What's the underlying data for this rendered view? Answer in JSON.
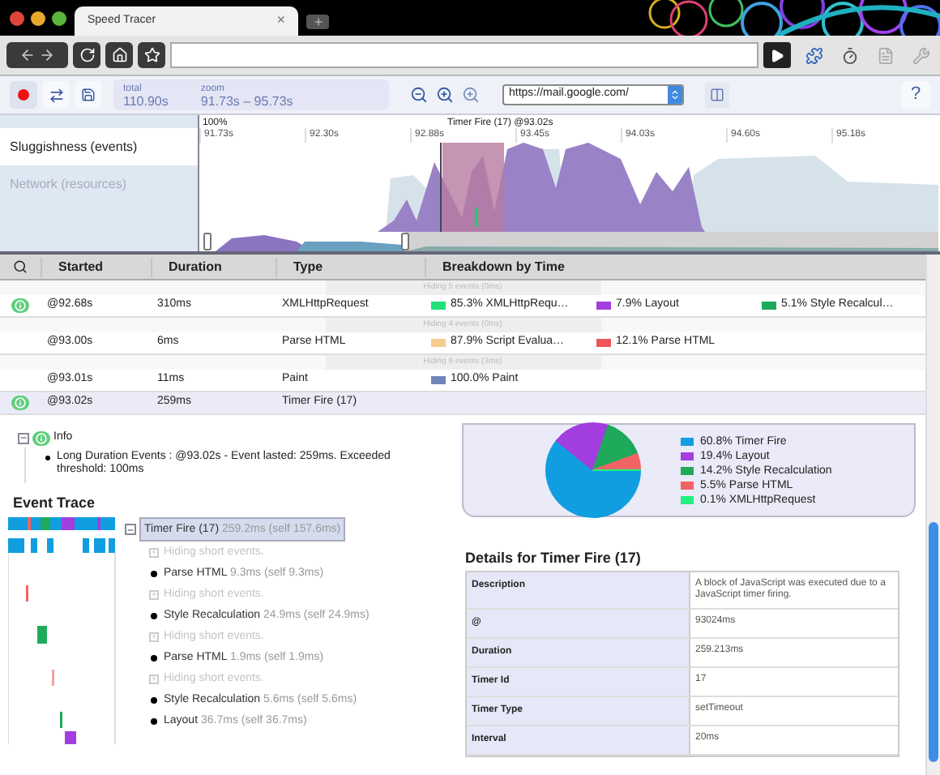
{
  "browser": {
    "tab_title": "Speed Tracer",
    "tab_close": "×"
  },
  "toolbar": {
    "total_label": "total",
    "total": "110.90s",
    "zoom_label": "zoom",
    "zoom": "91.73s – 95.73s",
    "url": "https://mail.google.com/",
    "help": "?"
  },
  "timeline": {
    "rows": [
      {
        "label": "Sluggishness (events)",
        "selected": true
      },
      {
        "label": "Network (resources)",
        "selected": false
      }
    ],
    "scale": "100%",
    "marker": "Timer Fire (17) @93.02s",
    "ticks": [
      "91.73s",
      "92.30s",
      "92.88s",
      "93.45s",
      "94.03s",
      "94.60s",
      "95.18s"
    ]
  },
  "table": {
    "columns": [
      "Started",
      "Duration",
      "Type",
      "Breakdown by Time"
    ],
    "rows": [
      {
        "kind": "hidden",
        "text": "Hiding 5 events (0ms)"
      },
      {
        "kind": "event",
        "info": true,
        "selected": false,
        "started": "@92.68s",
        "duration": "310ms",
        "type": "XMLHttpRequest",
        "breakdown": [
          {
            "color": "#22e07a",
            "text": "85.3% XMLHttpRequ…"
          },
          {
            "color": "#a23ee0",
            "text": "7.9% Layout"
          },
          {
            "color": "#1eaa5a",
            "text": "5.1% Style Recalcul…"
          }
        ]
      },
      {
        "kind": "hidden",
        "text": "Hiding 4 events (0ms)"
      },
      {
        "kind": "event",
        "info": false,
        "selected": false,
        "started": "@93.00s",
        "duration": "6ms",
        "type": "Parse HTML",
        "breakdown": [
          {
            "color": "#f6cc8c",
            "text": "87.9% Script Evalua…"
          },
          {
            "color": "#ee5555",
            "text": "12.1% Parse HTML"
          }
        ]
      },
      {
        "kind": "hidden",
        "text": "Hiding 6 events (3ms)"
      },
      {
        "kind": "event",
        "info": false,
        "selected": false,
        "started": "@93.01s",
        "duration": "11ms",
        "type": "Paint",
        "breakdown": [
          {
            "color": "#6f86b8",
            "text": "100.0% Paint"
          }
        ]
      },
      {
        "kind": "event",
        "info": true,
        "selected": true,
        "started": "@93.02s",
        "duration": "259ms",
        "type": "Timer Fire (17)",
        "breakdown": []
      }
    ]
  },
  "info": {
    "expanded": true,
    "title": "Info",
    "items": [
      "Long Duration Events : @93.02s - Event lasted: 259ms. Exceeded threshold: 100ms"
    ]
  },
  "pie": {
    "legend": [
      {
        "color": "#119ee0",
        "text": "60.8% Timer Fire"
      },
      {
        "color": "#a23ee0",
        "text": "19.4% Layout"
      },
      {
        "color": "#1eaa5a",
        "text": "14.2% Style Recalculation"
      },
      {
        "color": "#f06464",
        "text": "5.5% Parse HTML"
      },
      {
        "color": "#22f080",
        "text": "0.1% XMLHttpRequest"
      }
    ],
    "chart_data": {
      "type": "pie",
      "values": [
        60.8,
        19.4,
        14.2,
        5.5,
        0.1
      ]
    }
  },
  "event_trace": {
    "title": "Event Trace",
    "root": {
      "name": "Timer Fire (17)",
      "time": "259.2ms (self 157.6ms)",
      "expanded": true,
      "selected": true,
      "children": [
        {
          "kind": "hidden",
          "text": "Hiding short events."
        },
        {
          "kind": "event",
          "name": "Parse HTML",
          "time": "9.3ms (self 9.3ms)"
        },
        {
          "kind": "hidden",
          "text": "Hiding short events."
        },
        {
          "kind": "event",
          "name": "Style Recalculation",
          "time": "24.9ms (self 24.9ms)"
        },
        {
          "kind": "hidden",
          "text": "Hiding short events."
        },
        {
          "kind": "event",
          "name": "Parse HTML",
          "time": "1.9ms (self 1.9ms)"
        },
        {
          "kind": "hidden",
          "text": "Hiding short events."
        },
        {
          "kind": "event",
          "name": "Style Recalculation",
          "time": "5.6ms (self 5.6ms)"
        },
        {
          "kind": "event",
          "name": "Layout",
          "time": "36.7ms (self 36.7ms)"
        }
      ]
    }
  },
  "details": {
    "title": "Details for Timer Fire (17)",
    "rows": [
      {
        "label": "Description",
        "value": "A block of JavaScript was executed due to a JavaScript timer firing."
      },
      {
        "label": "@",
        "value": "93024ms"
      },
      {
        "label": "Duration",
        "value": "259.213ms"
      },
      {
        "label": "Timer Id",
        "value": "17"
      },
      {
        "label": "Timer Type",
        "value": "setTimeout"
      },
      {
        "label": "Interval",
        "value": "20ms"
      }
    ]
  }
}
